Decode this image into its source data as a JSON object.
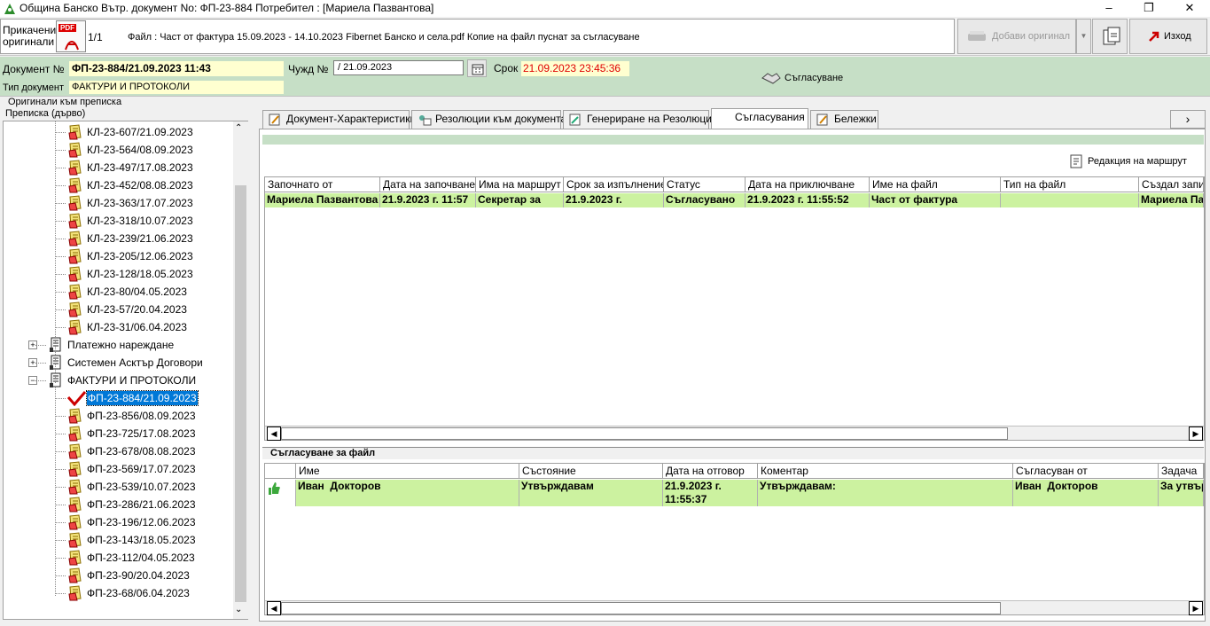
{
  "window": {
    "title": "Община Банско Вътр. документ No: ФП-23-884 Потребител : [Мариела Пазвантова]",
    "min_icon": "minimize-icon",
    "max_icon": "restore-icon",
    "close_icon": "close-icon"
  },
  "attach": {
    "label_line1": "Прикачени",
    "label_line2": "оригинали",
    "pdf_badge": "PDF",
    "page_count": "1/1",
    "file_text": "Файл : Част от фактура  15.09.2023 - 14.10.2023 Fibernet Банско и села.pdf Копие на файл пуснат за съгласуване",
    "add_original_label": "Добави оригинал",
    "exit_label": "Изход"
  },
  "document": {
    "number_label": "Документ №",
    "number_value": "ФП-23-884/21.09.2023 11:43",
    "foreign_label": "Чужд №",
    "foreign_value": "/ 21.09.2023",
    "deadline_label": "Срок",
    "deadline_value": "21.09.2023 23:45:36",
    "type_label": "Тип документ",
    "type_value": "ФАКТУРИ И ПРОТОКОЛИ",
    "approve_label": "Съгласуване",
    "originals_label": "Оригинали към преписка",
    "tree_label": "Преписка (дърво)"
  },
  "tree": {
    "items_top": [
      "КЛ-23-607/21.09.2023",
      "КЛ-23-564/08.09.2023",
      "КЛ-23-497/17.08.2023",
      "КЛ-23-452/08.08.2023",
      "КЛ-23-363/17.07.2023",
      "КЛ-23-318/10.07.2023",
      "КЛ-23-239/21.06.2023",
      "КЛ-23-205/12.06.2023",
      "КЛ-23-128/18.05.2023",
      "КЛ-23-80/04.05.2023",
      "КЛ-23-57/20.04.2023",
      "КЛ-23-31/06.04.2023"
    ],
    "groups": [
      "Платежно нареждане",
      "Системен Асктър Договори",
      "ФАКТУРИ И ПРОТОКОЛИ"
    ],
    "selected": "ФП-23-884/21.09.2023",
    "items_bottom": [
      "ФП-23-856/08.09.2023",
      "ФП-23-725/17.08.2023",
      "ФП-23-678/08.08.2023",
      "ФП-23-569/17.07.2023",
      "ФП-23-539/10.07.2023",
      "ФП-23-286/21.06.2023",
      "ФП-23-196/12.06.2023",
      "ФП-23-143/18.05.2023",
      "ФП-23-112/04.05.2023",
      "ФП-23-90/20.04.2023",
      "ФП-23-68/06.04.2023"
    ]
  },
  "tabs": [
    "Документ-Характеристики",
    "Резолюции към документа",
    "Генериране на Резолюции",
    "Съгласувания",
    "Бележки"
  ],
  "routes": {
    "edit_route_label": "Редакция на маршрут",
    "headers": [
      "Започнато от",
      "Дата на започване",
      "Има на маршрут",
      "Срок за изпълнение",
      "Статус",
      "Дата на приключване",
      "Име на файл",
      "Тип на файл",
      "Създал запис"
    ],
    "row": [
      "Мариела Пазвантова",
      "21.9.2023 г. 11:57",
      "Секретар за",
      "21.9.2023 г.",
      "Съгласувано",
      "21.9.2023 г. 11:55:52",
      "Част от фактура",
      "",
      "Мариела Па"
    ]
  },
  "file_approval": {
    "title": "Съгласуване за файл",
    "headers": [
      "",
      "Име",
      "Състояние",
      "Дата на отговор",
      "Коментар",
      "Съгласуван от",
      "Задача"
    ],
    "row": [
      "",
      "Иван  Докторов",
      "Утвърждавам",
      "21.9.2023 г.\n11:55:37",
      "Утвърждавам:",
      "Иван  Докторов",
      "За утвър"
    ]
  }
}
